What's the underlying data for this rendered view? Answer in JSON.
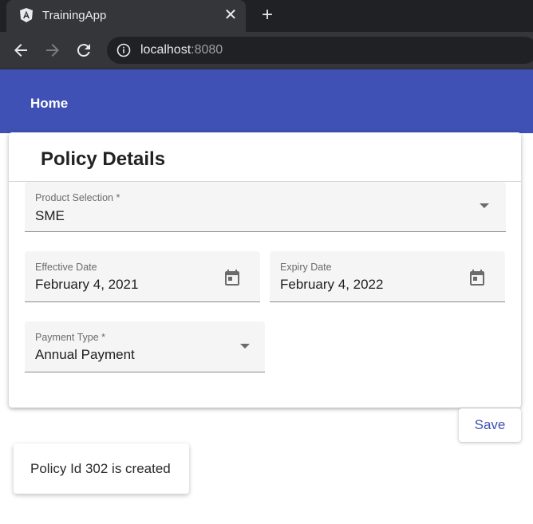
{
  "browser": {
    "tab_title": "TrainingApp",
    "close_glyph": "✕",
    "newtab_glyph": "+",
    "url_host": "localhost",
    "url_port": ":8080",
    "icons": [
      "angular-logo-icon",
      "close-icon",
      "plus-icon",
      "back-arrow-icon",
      "forward-arrow-icon",
      "reload-icon",
      "info-icon"
    ]
  },
  "appbar": {
    "home_label": "Home",
    "color": "#3f51b5"
  },
  "form": {
    "title": "Policy Details",
    "product": {
      "label": "Product Selection *",
      "value": "SME"
    },
    "effective_date": {
      "label": "Effective Date",
      "value": "February 4, 2021"
    },
    "expiry_date": {
      "label": "Expiry Date",
      "value": "February 4, 2022"
    },
    "payment_type": {
      "label": "Payment Type *",
      "value": "Annual Payment"
    }
  },
  "actions": {
    "save_label": "Save"
  },
  "snackbar": {
    "message": "Policy Id 302 is created"
  }
}
